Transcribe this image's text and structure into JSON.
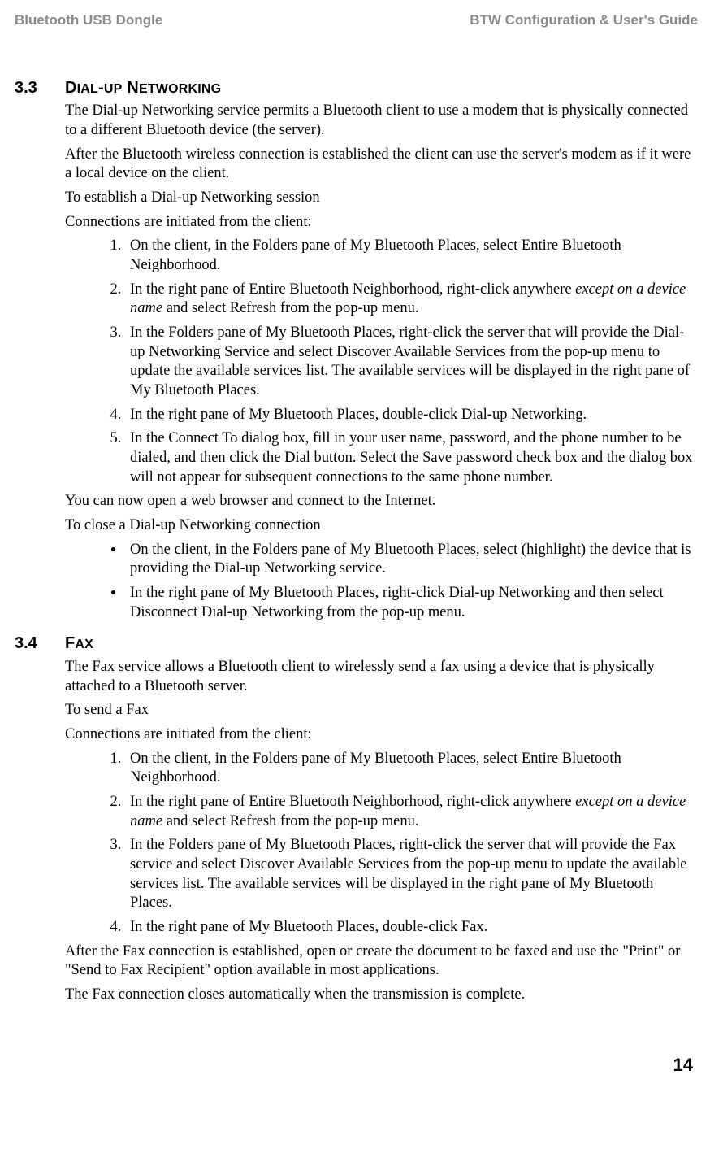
{
  "header": {
    "left": "Bluetooth USB Dongle",
    "right": "BTW Configuration & User's Guide"
  },
  "footer": {
    "page_number": "14"
  },
  "sections": {
    "s33": {
      "num": "3.3",
      "title_first": "D",
      "title_small1": "IAL",
      "title_mid1": "-",
      "title_small2": "UP",
      "title_mid2": " N",
      "title_small3": "ETWORKING",
      "p1": "The Dial-up Networking service permits a Bluetooth client to use a modem that is physically connected to a different Bluetooth device (the server).",
      "p2": "After the Bluetooth wireless connection is established the client can use the server's modem as if it were a local device on the client.",
      "p3": "To establish a Dial-up Networking session",
      "p4": "Connections are initiated from the client:",
      "list1": {
        "i1": "On the client, in the Folders pane of My Bluetooth Places, select Entire Bluetooth Neighborhood.",
        "i2_a": "In the right pane of Entire Bluetooth Neighborhood, right-click anywhere ",
        "i2_em": "except on a device name",
        "i2_b": " and select Refresh from the pop-up menu.",
        "i3": "In the Folders pane of My Bluetooth Places, right-click the server that will provide the Dial-up Networking Service and select Discover Available Services from the pop-up menu to update the available services list. The available services will be displayed in the right pane of My Bluetooth Places.",
        "i4": "In the right pane of My Bluetooth Places, double-click Dial-up Networking.",
        "i5": "In the Connect To dialog box, fill in your user name, password, and the phone number to be dialed, and then click the Dial button. Select the Save password check box and the dialog box will not appear for subsequent connections to the same phone number."
      },
      "p5": "You can now open a web browser and connect to the Internet.",
      "p6": "To close a Dial-up Networking connection",
      "list2": {
        "b1": "On the client, in the Folders pane of My Bluetooth Places, select (highlight) the device that is providing the Dial-up Networking service.",
        "b2": "In the right pane of My Bluetooth Places, right-click Dial-up Networking and then select Disconnect Dial-up Networking from the pop-up menu."
      }
    },
    "s34": {
      "num": "3.4",
      "title_first": "F",
      "title_small": "AX",
      "p1": "The Fax service allows a Bluetooth client to wirelessly send a fax using a device that is physically attached to a Bluetooth server.",
      "p2": "To send a Fax",
      "p3": "Connections are initiated from the client:",
      "list1": {
        "i1": "On the client, in the Folders pane of My Bluetooth Places, select Entire Bluetooth Neighborhood.",
        "i2_a": "In the right pane of Entire Bluetooth Neighborhood, right-click anywhere ",
        "i2_em": "except on a device name",
        "i2_b": " and select Refresh from the pop-up menu.",
        "i3": "In the Folders pane of My Bluetooth Places, right-click the server that will provide the Fax service and select Discover Available Services from the pop-up menu to update the available services list. The available services will be displayed in the right pane of My Bluetooth Places.",
        "i4": "In the right pane of My Bluetooth Places, double-click Fax."
      },
      "p4": "After the Fax connection is established, open or create the document to be faxed and use the \"Print\" or \"Send to Fax Recipient\" option available in most applications.",
      "p5": "The Fax connection closes automatically when the transmission is complete."
    }
  }
}
